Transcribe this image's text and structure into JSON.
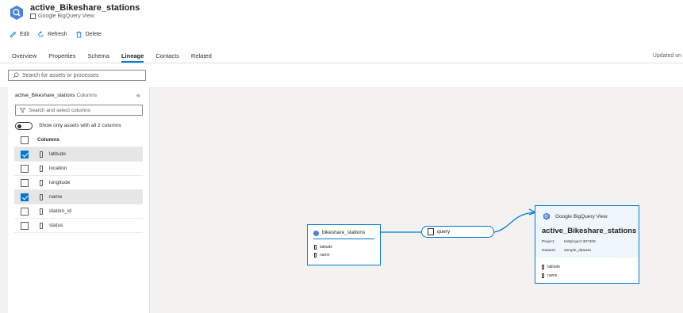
{
  "header": {
    "title": "active_Bikeshare_stations",
    "subtitle": "Google BigQuery View"
  },
  "toolbar": {
    "edit": "Edit",
    "refresh": "Refresh",
    "delete": "Delete"
  },
  "tabs": [
    {
      "label": "Overview",
      "active": false
    },
    {
      "label": "Properties",
      "active": false
    },
    {
      "label": "Schema",
      "active": false
    },
    {
      "label": "Lineage",
      "active": true
    },
    {
      "label": "Contacts",
      "active": false
    },
    {
      "label": "Related",
      "active": false
    }
  ],
  "updated_text": "Updated on",
  "search": {
    "placeholder": "Search for assets or processes"
  },
  "panel": {
    "asset": "active_Bikeshare_stations",
    "columns_word": "Columns",
    "collapse_glyph": "«",
    "column_search_placeholder": "Search and select columns",
    "toggle_label": "Show only assets with all 2 columns",
    "header": "Columns",
    "rows": [
      {
        "name": "latitude",
        "checked": true
      },
      {
        "name": "location",
        "checked": false
      },
      {
        "name": "longitude",
        "checked": false
      },
      {
        "name": "name",
        "checked": true
      },
      {
        "name": "station_id",
        "checked": false
      },
      {
        "name": "status",
        "checked": false
      }
    ]
  },
  "lineage": {
    "source": {
      "name": "bikeshare_stations",
      "columns": [
        "latitude",
        "name"
      ]
    },
    "process": {
      "name": "query"
    },
    "target": {
      "type": "Google BigQuery View",
      "name": "active_Bikeshare_stations",
      "project_label": "Project:",
      "project": "testproject-307406",
      "dataset_label": "Dataset:",
      "dataset": "sample_dataset",
      "columns": [
        "latitude",
        "name"
      ]
    }
  },
  "colors": {
    "accent": "#0078d4",
    "canvas": "#f3f2f1",
    "selected_row": "#e6e6e6"
  }
}
